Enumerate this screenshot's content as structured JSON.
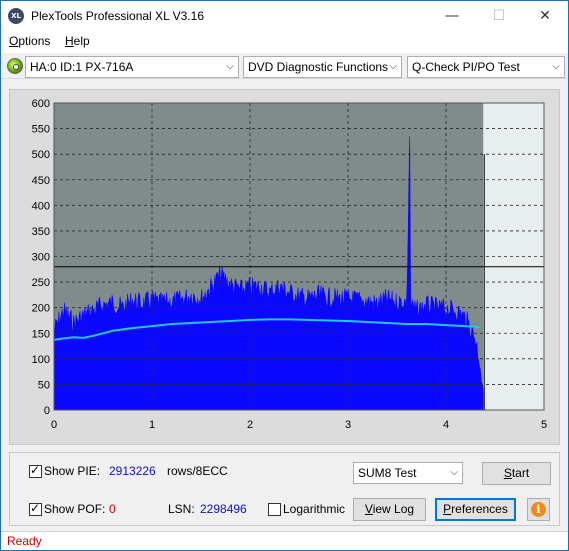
{
  "window": {
    "title": "PlexTools Professional XL V3.16",
    "icon_label": "XL",
    "minimize": "—",
    "maximize": "☐",
    "close": "✕"
  },
  "menu": {
    "options": {
      "accel": "O",
      "rest": "ptions"
    },
    "help": {
      "accel": "H",
      "rest": "elp"
    }
  },
  "toolbar": {
    "drive": "HA:0 ID:1  PX-716A",
    "function": "DVD Diagnostic Functions",
    "test": "Q-Check PI/PO Test",
    "chevron": "⌵"
  },
  "chart_data": {
    "type": "area",
    "xlim": [
      0,
      5
    ],
    "ylim": [
      0,
      600
    ],
    "x_ticks": [
      "0",
      "1",
      "2",
      "3",
      "4",
      "5"
    ],
    "y_ticks": [
      "0",
      "50",
      "100",
      "150",
      "200",
      "250",
      "300",
      "350",
      "400",
      "450",
      "500",
      "550",
      "600"
    ],
    "threshold_line": 280,
    "end_marker_x": 4.38,
    "end_marker_y": 500,
    "colors": {
      "plot_bg": "#808b8b",
      "plot_bg_right": "#e8eeee",
      "pie_fill": "#0a08ff",
      "average_line": "#20c8e8",
      "grid": "#2a2a2a",
      "threshold": "#000000"
    },
    "series": [
      {
        "kind": "pie_max",
        "x": [
          0.0,
          0.1,
          0.2,
          0.3,
          0.4,
          0.5,
          0.6,
          0.7,
          0.8,
          0.9,
          1.0,
          1.1,
          1.2,
          1.3,
          1.4,
          1.5,
          1.6,
          1.7,
          1.8,
          1.9,
          2.0,
          2.1,
          2.2,
          2.3,
          2.4,
          2.5,
          2.6,
          2.7,
          2.8,
          2.9,
          3.0,
          3.1,
          3.2,
          3.3,
          3.4,
          3.5,
          3.6,
          3.63,
          3.64,
          3.66,
          3.7,
          3.8,
          3.9,
          4.0,
          4.1,
          4.2,
          4.25,
          4.3,
          4.35,
          4.38
        ],
        "y": [
          175,
          215,
          190,
          205,
          215,
          225,
          230,
          220,
          235,
          228,
          235,
          230,
          232,
          236,
          245,
          238,
          260,
          285,
          265,
          255,
          260,
          262,
          250,
          262,
          250,
          242,
          238,
          245,
          240,
          238,
          238,
          235,
          232,
          228,
          238,
          230,
          232,
          535,
          230,
          220,
          215,
          225,
          220,
          218,
          215,
          200,
          180,
          160,
          110,
          35
        ]
      },
      {
        "kind": "pie_average",
        "x": [
          0.0,
          0.1,
          0.2,
          0.3,
          0.4,
          0.5,
          0.6,
          0.8,
          1.0,
          1.2,
          1.4,
          1.6,
          1.8,
          2.0,
          2.2,
          2.4,
          2.6,
          2.8,
          3.0,
          3.2,
          3.4,
          3.6,
          3.8,
          4.0,
          4.2,
          4.35
        ],
        "y": [
          137,
          140,
          142,
          141,
          145,
          150,
          155,
          160,
          164,
          168,
          170,
          172,
          174,
          176,
          177,
          177,
          176,
          175,
          174,
          172,
          170,
          168,
          168,
          166,
          164,
          162
        ]
      }
    ]
  },
  "bottom": {
    "show_pie_label": "Show PIE:",
    "pie_value": "2913226",
    "pie_unit": "rows/8ECC",
    "show_pof_label": "Show POF:",
    "pof_value": "0",
    "lsn_label": "LSN:",
    "lsn_value": "2298496",
    "logarithmic_label": "Logarithmic",
    "test_mode": "SUM8 Test",
    "start": {
      "accel": "S",
      "rest": "tart"
    },
    "view_log": {
      "accel": "V",
      "rest": "iew Log"
    },
    "preferences": {
      "accel": "P",
      "rest": "references"
    },
    "info": "i"
  },
  "status": {
    "text": "Ready"
  }
}
